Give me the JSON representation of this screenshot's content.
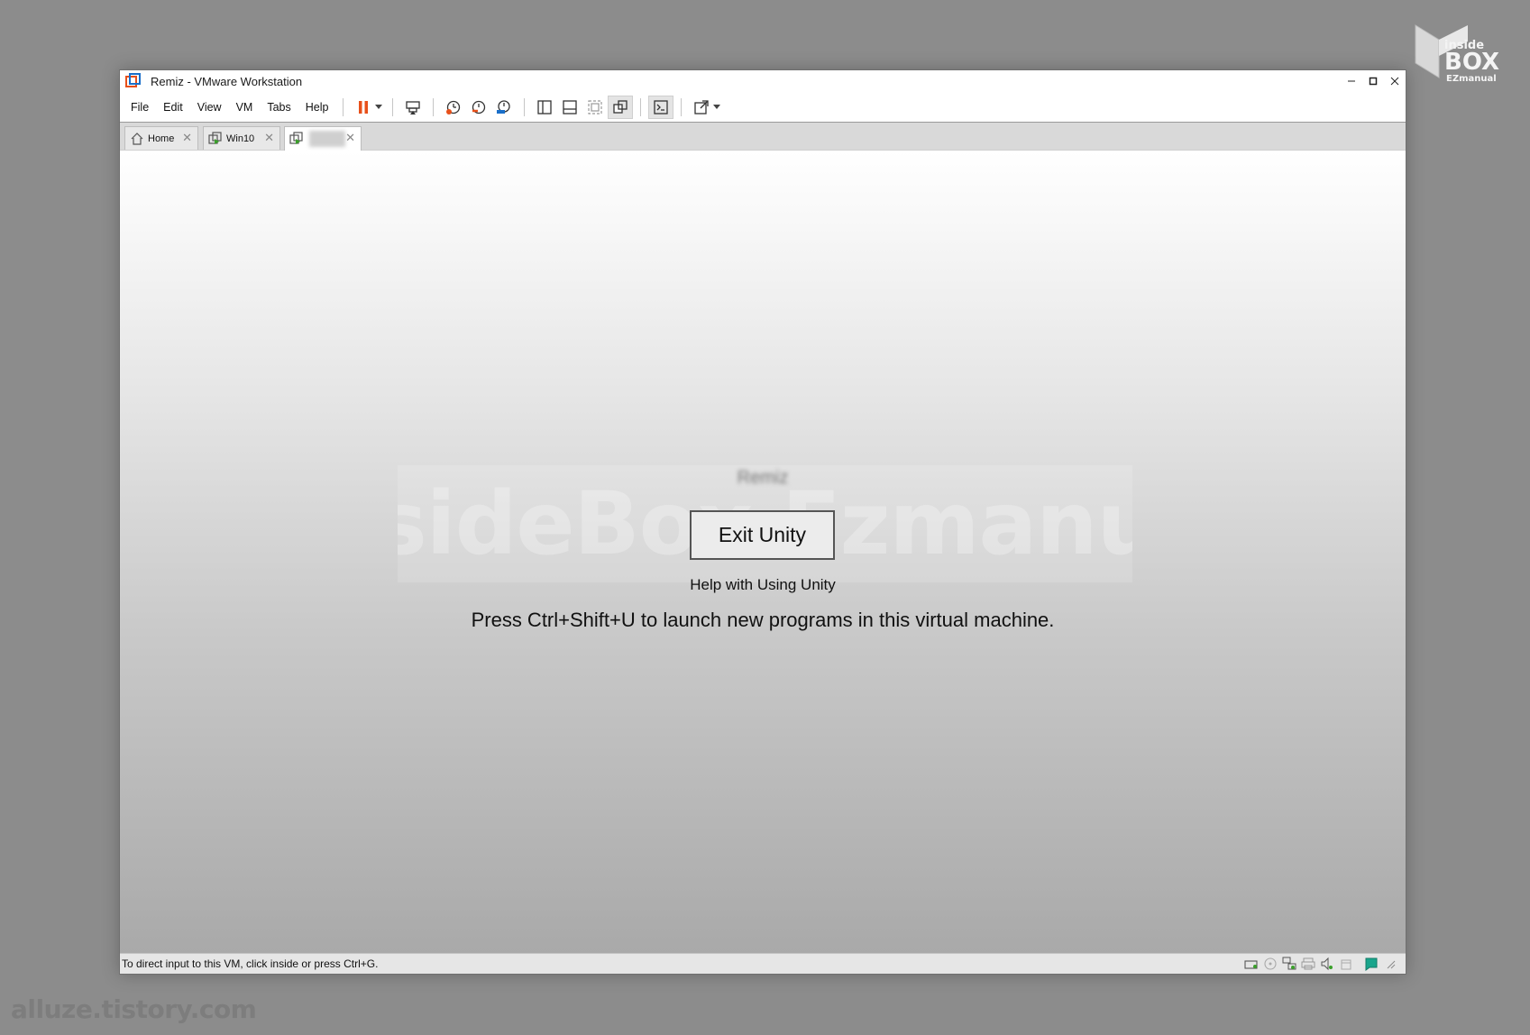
{
  "window": {
    "title": "Remiz - VMware Workstation"
  },
  "menu": {
    "items": [
      "File",
      "Edit",
      "View",
      "VM",
      "Tabs",
      "Help"
    ]
  },
  "tabs": [
    {
      "label": "Home"
    },
    {
      "label": "Win10"
    },
    {
      "label": ""
    }
  ],
  "vm": {
    "name": "Remiz",
    "watermark": "insideBox Ezmanual",
    "exit_unity_label": "Exit Unity",
    "help_link": "Help with Using Unity",
    "hint": "Press Ctrl+Shift+U to launch new programs in this virtual machine."
  },
  "status": {
    "text": "To direct input to this VM, click inside or press Ctrl+G."
  },
  "watermarks": {
    "logo_top": "inside",
    "logo_main": "BOX",
    "logo_sub": "EZmanual",
    "url": "alluze.tistory.com"
  },
  "colors": {
    "pause": "#e8501a",
    "accent_blue": "#1a6fc9",
    "vm_status": "#19a58c"
  }
}
